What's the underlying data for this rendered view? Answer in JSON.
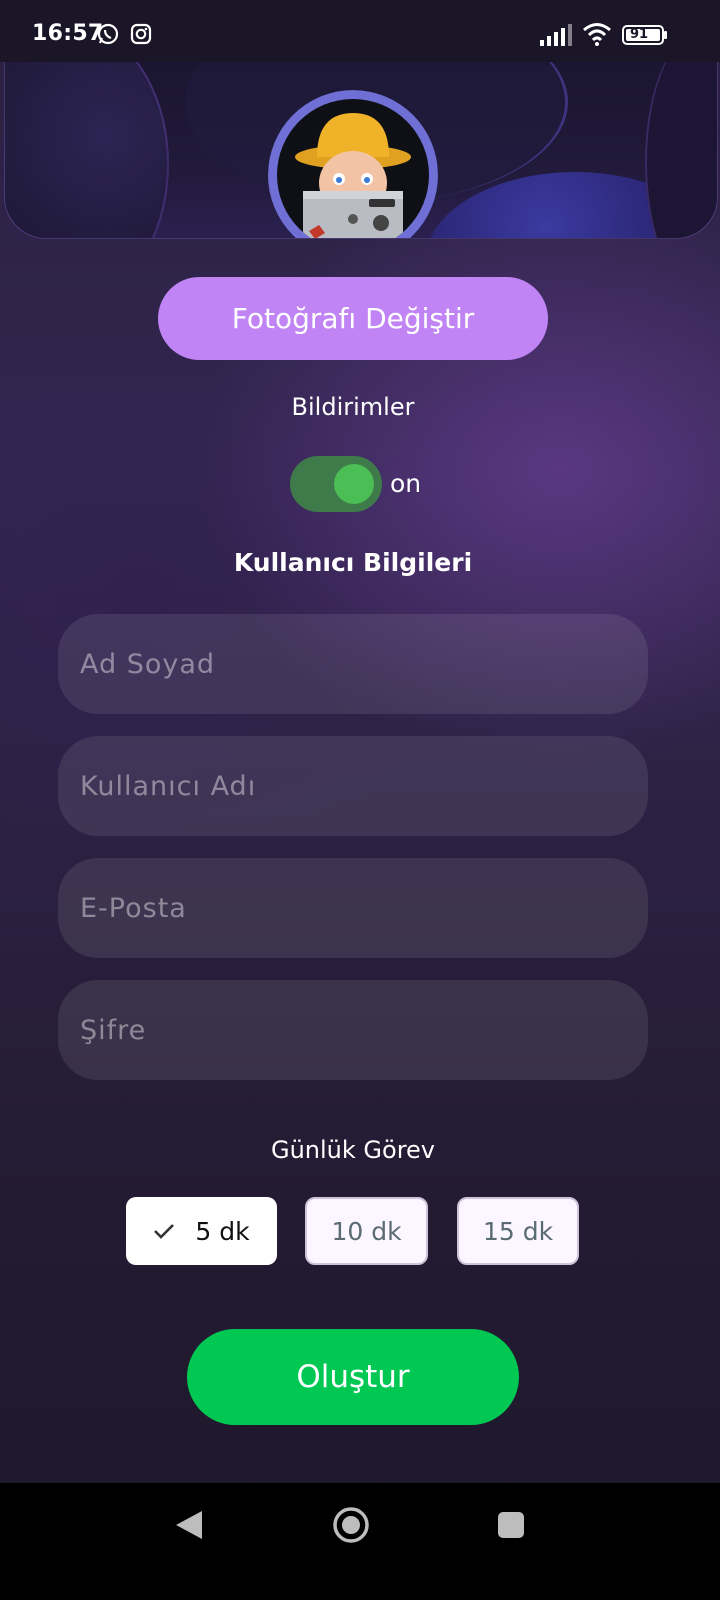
{
  "status_bar": {
    "time": "16:57",
    "battery_level": "91",
    "app_icons": [
      "whatsapp-icon",
      "instagram-icon"
    ],
    "system_icons": [
      "signal-icon",
      "wifi-icon",
      "battery-icon"
    ]
  },
  "header": {
    "avatar_alt": "profile-avatar"
  },
  "profile": {
    "change_photo_label": "Fotoğrafı Değiştir",
    "notifications_label": "Bildirimler",
    "notifications_state": "on",
    "notifications_enabled": true
  },
  "form": {
    "section_title": "Kullanıcı Bilgileri",
    "fields": [
      {
        "placeholder": "Ad Soyad",
        "value": ""
      },
      {
        "placeholder": "Kullanıcı Adı",
        "value": ""
      },
      {
        "placeholder": "E-Posta",
        "value": ""
      },
      {
        "placeholder": "Şifre",
        "value": ""
      }
    ]
  },
  "daily_task": {
    "title": "Günlük Görev",
    "options": [
      {
        "label": "5 dk",
        "selected": true
      },
      {
        "label": "10 dk",
        "selected": false
      },
      {
        "label": "15 dk",
        "selected": false
      }
    ]
  },
  "actions": {
    "create_label": "Oluştur"
  },
  "colors": {
    "accent_purple": "#c084f5",
    "create_green": "#00c853",
    "toggle_green": "#4bbf56"
  },
  "nav_bar": {
    "items": [
      "back-icon",
      "home-icon",
      "recents-icon"
    ]
  }
}
